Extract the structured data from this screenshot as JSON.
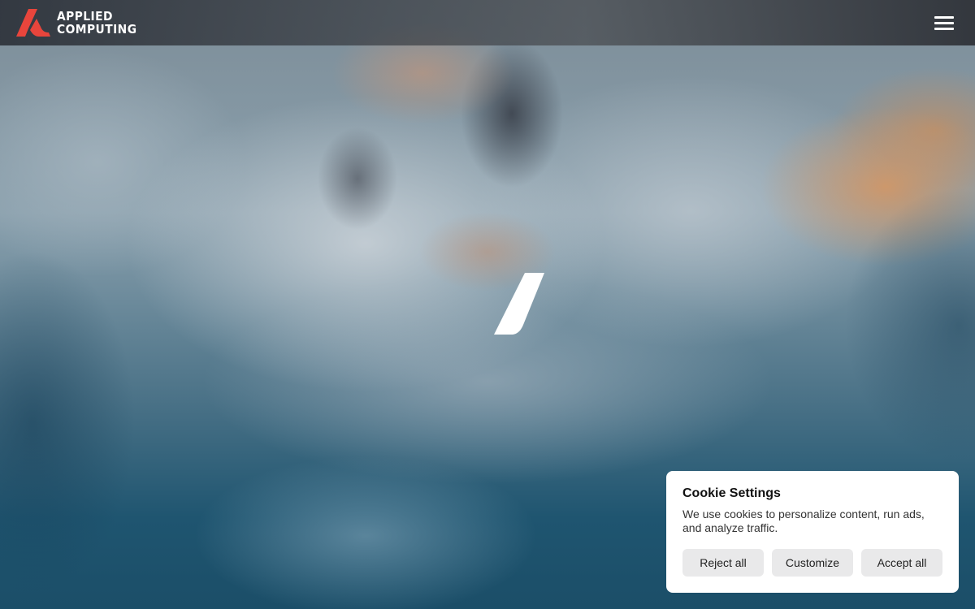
{
  "header": {
    "logo_line1": "APPLIED",
    "logo_line2": "COMPUTING",
    "menu_icon": "hamburger-menu-icon"
  },
  "hero": {
    "center_icon": "slash-logo-mark"
  },
  "cookie_banner": {
    "title": "Cookie Settings",
    "description": "We use cookies to personalize content, run ads, and analyze traffic.",
    "buttons": {
      "reject": "Reject all",
      "customize": "Customize",
      "accept": "Accept all"
    }
  },
  "colors": {
    "brand_accent": "#e8453c",
    "header_bg": "#2f343b",
    "button_bg": "#e9e9ea",
    "card_bg": "#ffffff"
  }
}
